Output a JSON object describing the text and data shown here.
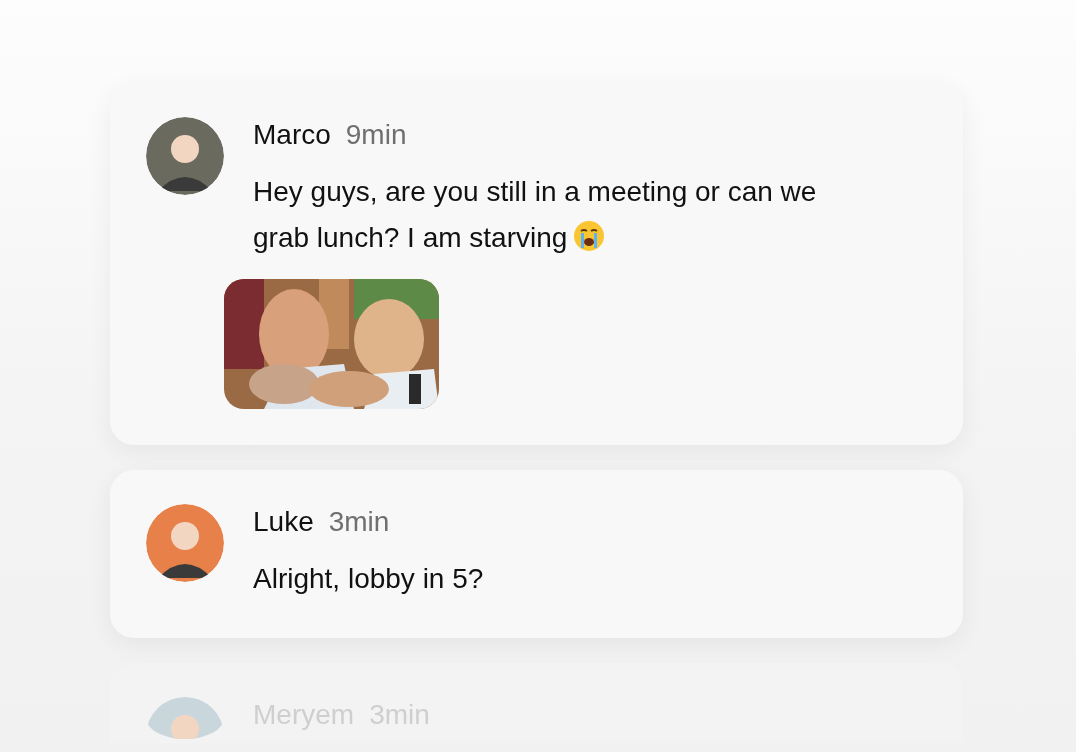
{
  "messages": [
    {
      "author": "Marco",
      "time": "9min",
      "text": "Hey guys, are you still in a meeting or can we grab lunch? I am starving",
      "crying_emoji": true,
      "color": "#6b6a5e",
      "faded": false
    },
    {
      "author": "Luke",
      "time": "3min",
      "text": "Alright, lobby in 5?",
      "color": "#e8804a",
      "faded": false
    },
    {
      "author": "Meryem",
      "time": "3min",
      "color": "#c9d6dc",
      "faded": true
    }
  ]
}
